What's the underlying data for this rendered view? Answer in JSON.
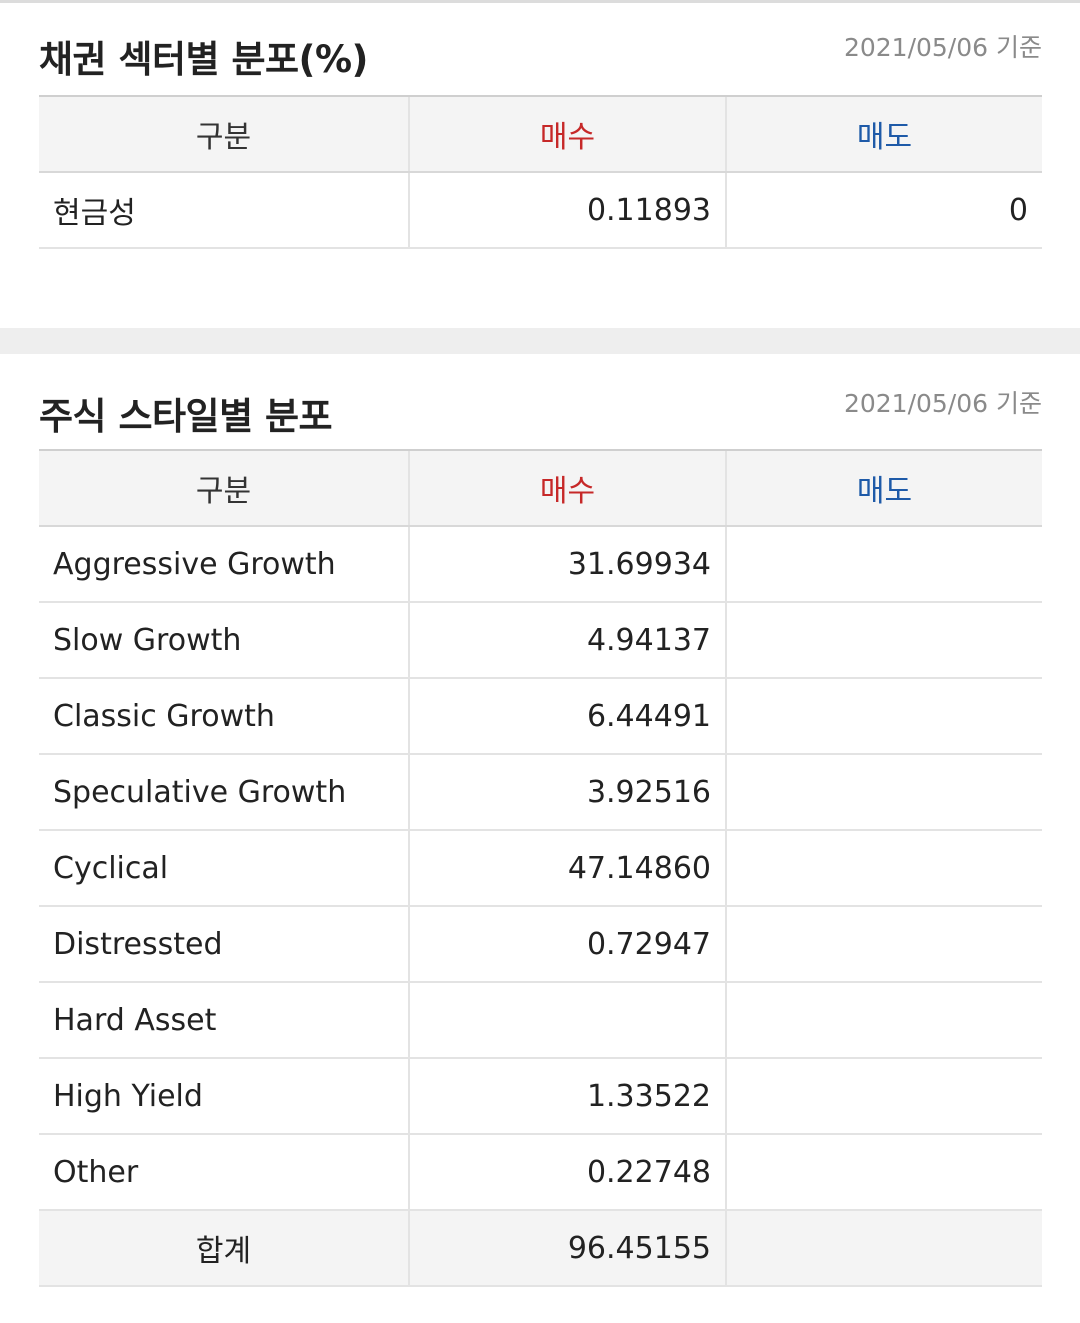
{
  "bond_sector": {
    "title": "채권 섹터별 분포(%)",
    "date": "2021/05/06 기준",
    "headers": {
      "label": "구분",
      "buy": "매수",
      "sell": "매도"
    },
    "rows": [
      {
        "label": "현금성",
        "buy": "0.11893",
        "sell": "0"
      }
    ]
  },
  "stock_style": {
    "title": "주식 스타일별 분포",
    "date": "2021/05/06 기준",
    "headers": {
      "label": "구분",
      "buy": "매수",
      "sell": "매도"
    },
    "rows": [
      {
        "label": "Aggressive Growth",
        "buy": "31.69934",
        "sell": ""
      },
      {
        "label": "Slow Growth",
        "buy": "4.94137",
        "sell": ""
      },
      {
        "label": "Classic Growth",
        "buy": "6.44491",
        "sell": ""
      },
      {
        "label": "Speculative Growth",
        "buy": "3.92516",
        "sell": ""
      },
      {
        "label": "Cyclical",
        "buy": "47.14860",
        "sell": ""
      },
      {
        "label": "Distressted",
        "buy": "0.72947",
        "sell": ""
      },
      {
        "label": "Hard Asset",
        "buy": "",
        "sell": ""
      },
      {
        "label": "High Yield",
        "buy": "1.33522",
        "sell": ""
      },
      {
        "label": "Other",
        "buy": "0.22748",
        "sell": ""
      }
    ],
    "total": {
      "label": "합계",
      "buy": "96.45155",
      "sell": ""
    }
  },
  "colors": {
    "buy": "#c62828",
    "sell": "#1e5aa8",
    "header_bg": "#f4f4f4",
    "date": "#8a8a8a"
  }
}
